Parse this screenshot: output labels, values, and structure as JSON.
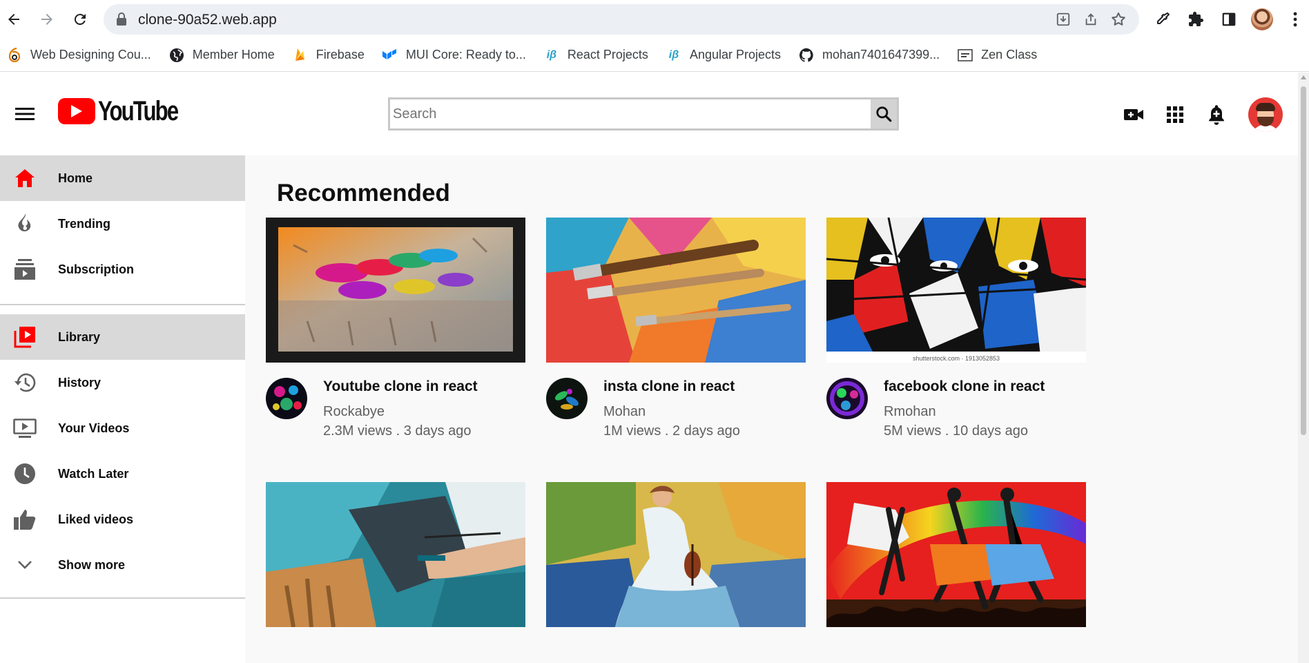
{
  "browser": {
    "url": "clone-90a52.web.app",
    "bookmarks": [
      {
        "label": "Web Designing Cou...",
        "icon": "six-logo-icon"
      },
      {
        "label": "Member Home",
        "icon": "globe-icon"
      },
      {
        "label": "Firebase",
        "icon": "firebase-icon"
      },
      {
        "label": "MUI Core: Ready to...",
        "icon": "mui-icon"
      },
      {
        "label": "React Projects",
        "icon": "ib-icon"
      },
      {
        "label": "Angular Projects",
        "icon": "ib-icon"
      },
      {
        "label": "mohan7401647399...",
        "icon": "github-icon"
      },
      {
        "label": "Zen Class",
        "icon": "zen-icon"
      }
    ]
  },
  "header": {
    "logo_text": "YouTube",
    "search_placeholder": "Search"
  },
  "sidebar": {
    "items": [
      {
        "label": "Home",
        "icon": "home-icon"
      },
      {
        "label": "Trending",
        "icon": "fire-icon"
      },
      {
        "label": "Subscription",
        "icon": "subscriptions-icon"
      },
      {
        "label": "Library",
        "icon": "library-icon"
      },
      {
        "label": "History",
        "icon": "history-icon"
      },
      {
        "label": "Your Videos",
        "icon": "your-videos-icon"
      },
      {
        "label": "Watch Later",
        "icon": "clock-icon"
      },
      {
        "label": "Liked videos",
        "icon": "thumb-up-icon"
      },
      {
        "label": "Show more",
        "icon": "chevron-down-icon"
      }
    ]
  },
  "main": {
    "section_title": "Recommended",
    "videos": [
      {
        "title": "Youtube clone in react",
        "channel": "Rockabye",
        "stats": "2.3M views . 3 days ago"
      },
      {
        "title": "insta clone in react",
        "channel": "Mohan",
        "stats": "1M views . 2 days ago"
      },
      {
        "title": "facebook clone in react",
        "channel": "Rmohan",
        "stats": "5M views . 10 days ago"
      }
    ],
    "thumb_caption": "shutterstock.com · 1913052853"
  },
  "colors": {
    "brand_red": "#ff0000",
    "active_bg": "#d9d9d9",
    "main_bg": "#f9f9f9"
  }
}
